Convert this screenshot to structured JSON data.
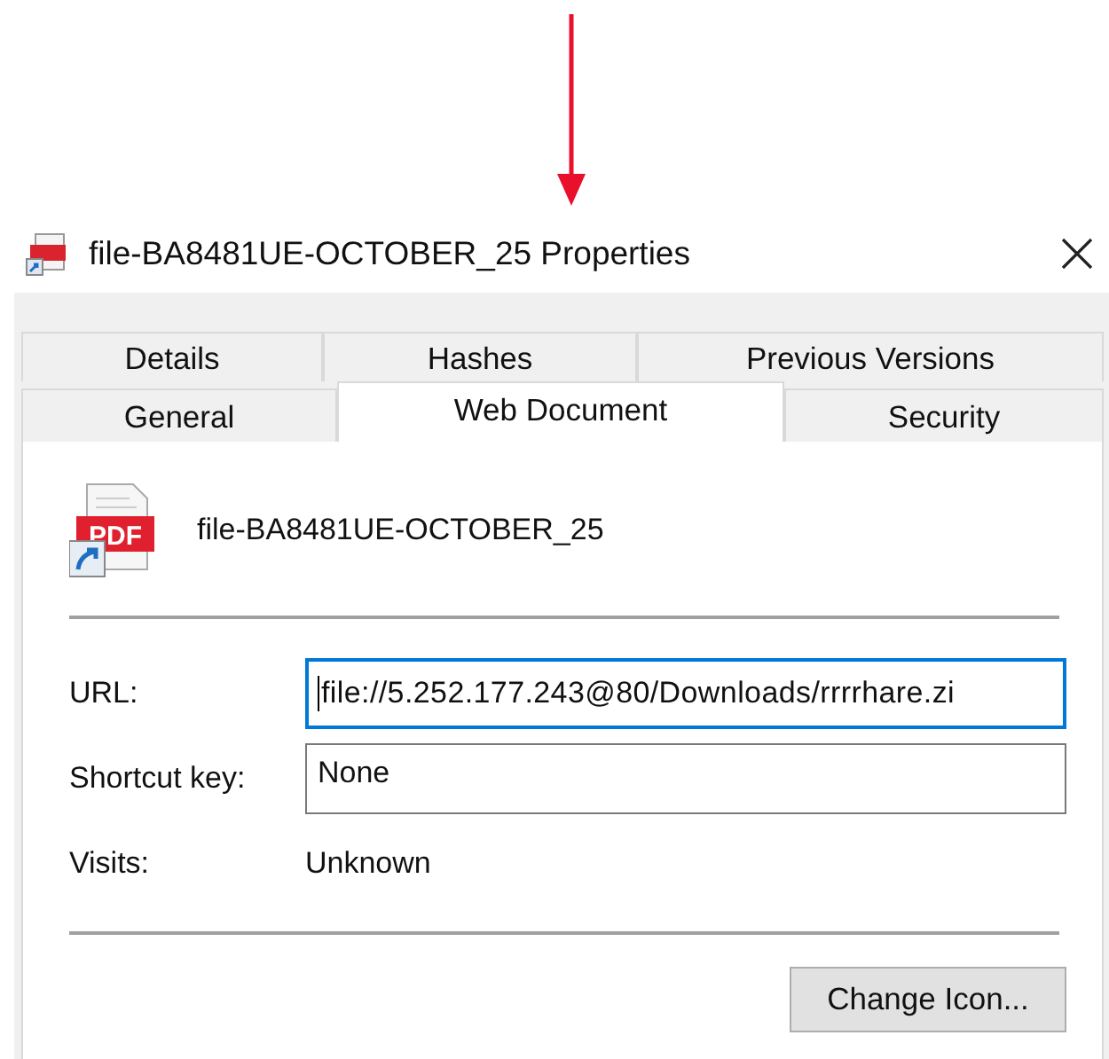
{
  "window": {
    "title": "file-BA8481UE-OCTOBER_25 Properties"
  },
  "tab_rows": [
    [
      {
        "label": "Details",
        "selected": false
      },
      {
        "label": "Hashes",
        "selected": false
      },
      {
        "label": "Previous Versions",
        "selected": false
      }
    ],
    [
      {
        "label": "General",
        "selected": false
      },
      {
        "label": "Web Document",
        "selected": true
      },
      {
        "label": "Security",
        "selected": false
      }
    ]
  ],
  "file": {
    "name": "file-BA8481UE-OCTOBER_25",
    "icon_label": "PDF"
  },
  "fields": [
    {
      "kind": "input",
      "label": "URL:",
      "value": "file://5.252.177.243@80/Downloads/rrrrhare.zi",
      "focused": true
    },
    {
      "kind": "input",
      "label": "Shortcut key:",
      "value": "None",
      "focused": false
    },
    {
      "kind": "text",
      "label": "Visits:",
      "value": "Unknown"
    }
  ],
  "buttons": [
    "Change Icon..."
  ]
}
